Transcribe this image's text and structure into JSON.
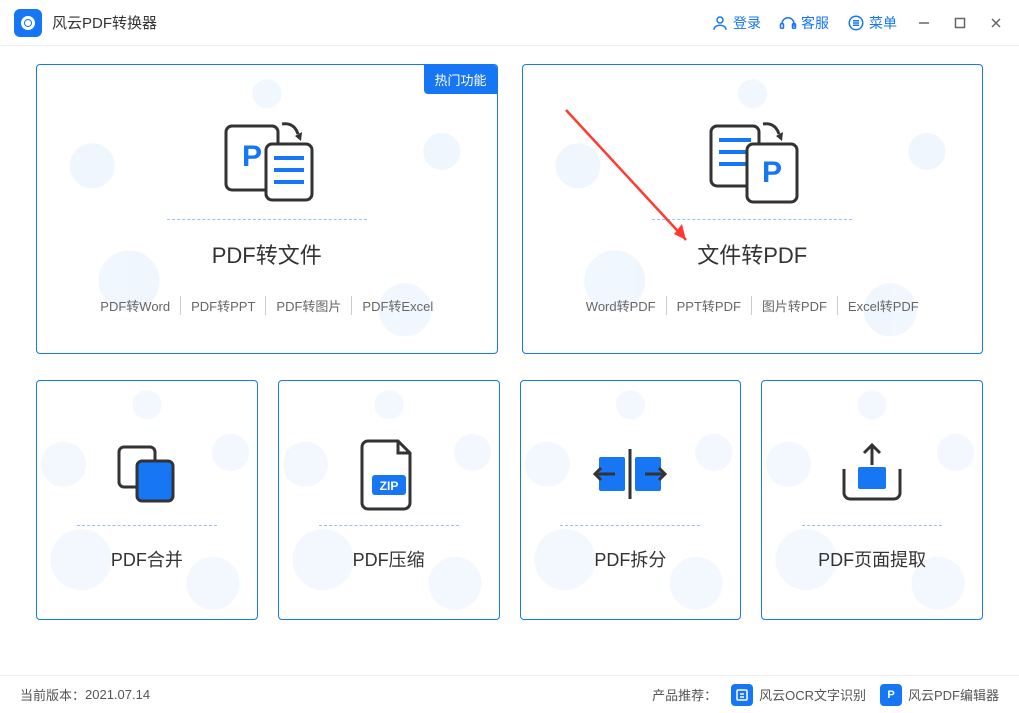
{
  "app": {
    "title": "风云PDF转换器"
  },
  "titlebar": {
    "login": "登录",
    "support": "客服",
    "menu": "菜单"
  },
  "cards": {
    "pdf_to_file": {
      "badge": "热门功能",
      "title": "PDF转文件",
      "subtypes": [
        "PDF转Word",
        "PDF转PPT",
        "PDF转图片",
        "PDF转Excel"
      ]
    },
    "file_to_pdf": {
      "title": "文件转PDF",
      "subtypes": [
        "Word转PDF",
        "PPT转PDF",
        "图片转PDF",
        "Excel转PDF"
      ]
    },
    "merge": {
      "title": "PDF合并"
    },
    "compress": {
      "title": "PDF压缩"
    },
    "split": {
      "title": "PDF拆分"
    },
    "extract": {
      "title": "PDF页面提取"
    }
  },
  "footer": {
    "version_label": "当前版本：",
    "version": "2021.07.14",
    "recommend_label": "产品推荐：",
    "ocr": "风云OCR文字识别",
    "editor": "风云PDF编辑器"
  },
  "colors": {
    "primary": "#1676f3",
    "accent_red": "#ff3b30"
  }
}
